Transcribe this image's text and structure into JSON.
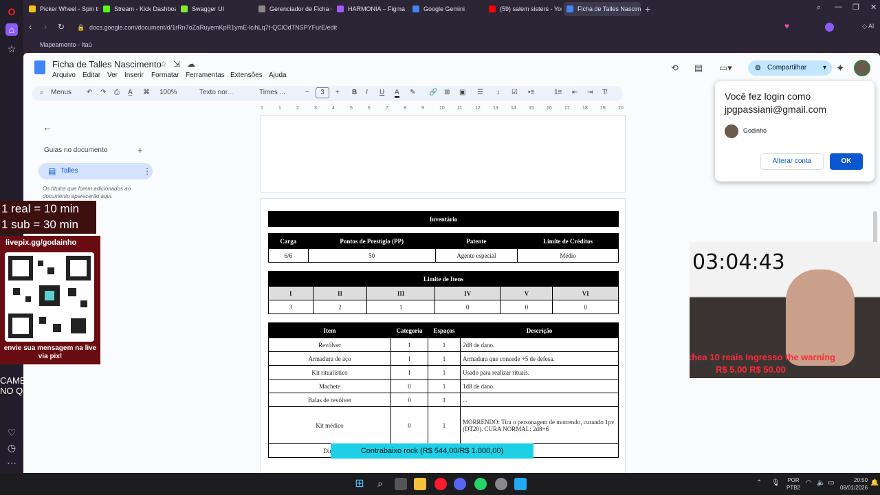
{
  "tabs": [
    {
      "label": "Picker Wheel - Spin the W",
      "color": "#f5c21b"
    },
    {
      "label": "Stream - Kick Dashboard",
      "color": "#53fc18"
    },
    {
      "label": "Swagger UI",
      "color": "#85ea2d"
    },
    {
      "label": "Gerenciador de Ficha de R",
      "color": "#888888"
    },
    {
      "label": "HARMONIA – Figma",
      "color": "#a259ff"
    },
    {
      "label": "Google Gemini",
      "color": "#4285f4"
    },
    {
      "label": "(59) salem sisters - YouTu",
      "color": "#ff0000"
    },
    {
      "label": "Ficha de Talles Nasciment",
      "color": "#4285f4"
    }
  ],
  "url": "docs.google.com/document/d/1rRn7oZaRuyemKpR1ymE-lcihLq7t-QClOdTNSPYFurE/edit",
  "bookmark": "Mapeamento - Itaú",
  "doc": {
    "title": "Ficha de Talles Nascimento",
    "menus": [
      "Arquivo",
      "Editar",
      "Ver",
      "Inserir",
      "Formatar",
      "Ferramentas",
      "Extensões",
      "Ajuda"
    ],
    "share": "Compartilhar",
    "toolbar": {
      "search": "Menus",
      "zoom": "100%",
      "style": "Texto nor...",
      "font": "Times ...",
      "size": "3"
    },
    "ruler": [
      "1",
      "1",
      "2",
      "3",
      "4",
      "5",
      "6",
      "7",
      "8",
      "9",
      "10",
      "11",
      "12",
      "13",
      "14",
      "15",
      "16",
      "17",
      "18",
      "19",
      "20"
    ]
  },
  "outline": {
    "heading": "Guias no documento",
    "item": "Talles",
    "hint": "Os títulos que forem adicionados ao documento aparecerão aqui."
  },
  "inventory": {
    "title": "Inventário",
    "cols": [
      "Carga",
      "Pontos de Prestígio (PP)",
      "Patente",
      "Limite de Créditos"
    ],
    "vals": [
      "6/6",
      "50",
      "Agente especial",
      "Médio"
    ],
    "limit_title": "Limite de Itens",
    "limit_cols": [
      "I",
      "II",
      "III",
      "IV",
      "V",
      "VI"
    ],
    "limit_vals": [
      "3",
      "2",
      "1",
      "0",
      "0",
      "0"
    ],
    "item_cols": [
      "Item",
      "Categoria",
      "Espaços",
      "Descrição"
    ],
    "items": [
      {
        "name": "Revólver",
        "cat": "1",
        "esp": "1",
        "desc": "2d8 de dano."
      },
      {
        "name": "Armadura de aço",
        "cat": "I",
        "esp": "1",
        "desc": "Armadura que concede +5 de defesa."
      },
      {
        "name": "Kit ritualístico",
        "cat": "I",
        "esp": "1",
        "desc": "Usado para realizar rituais."
      },
      {
        "name": "Machete",
        "cat": "0",
        "esp": "1",
        "desc": "1d8 de dano."
      },
      {
        "name": "Balas de revólver",
        "cat": "0",
        "esp": "1",
        "desc": "..."
      },
      {
        "name": "Kit médico",
        "cat": "0",
        "esp": "1",
        "desc": "MORRENDO: Tira o personagem de morrendo, curando 1pv (DT20). CURA NORMAL: 2d8+6"
      },
      {
        "name": "Dinh",
        "cat": "",
        "esp": "",
        "desc": ""
      }
    ]
  },
  "popup": {
    "line1": "Você fez login como",
    "email": "jpgpassiani@gmail.com",
    "account": "Godinho",
    "switch": "Alterar conta",
    "ok": "OK"
  },
  "stream": {
    "timer": "03:04:43",
    "ticker": "chea  10 reais  Ingresso the warning",
    "ticker2": "R$ 5.00   R$ 50.00",
    "rate1": "1 real = 10 min",
    "rate2": "1 sub = 30 min",
    "livepix": "livepix.gg/godainho",
    "qrcap": "envie sua mensagem na live via pix!",
    "cam": "CAME",
    "camq": "NO Q",
    "goal": "Contrabaixo rock (R$ 544,00/R$ 1.000,00)"
  },
  "taskbar": {
    "lang": "POR",
    "layout": "PTB2",
    "time": "20:50",
    "date": "08/01/2026"
  },
  "colors": {
    "docblue": "#0b57d0",
    "sharebg": "#c2e7ff"
  }
}
